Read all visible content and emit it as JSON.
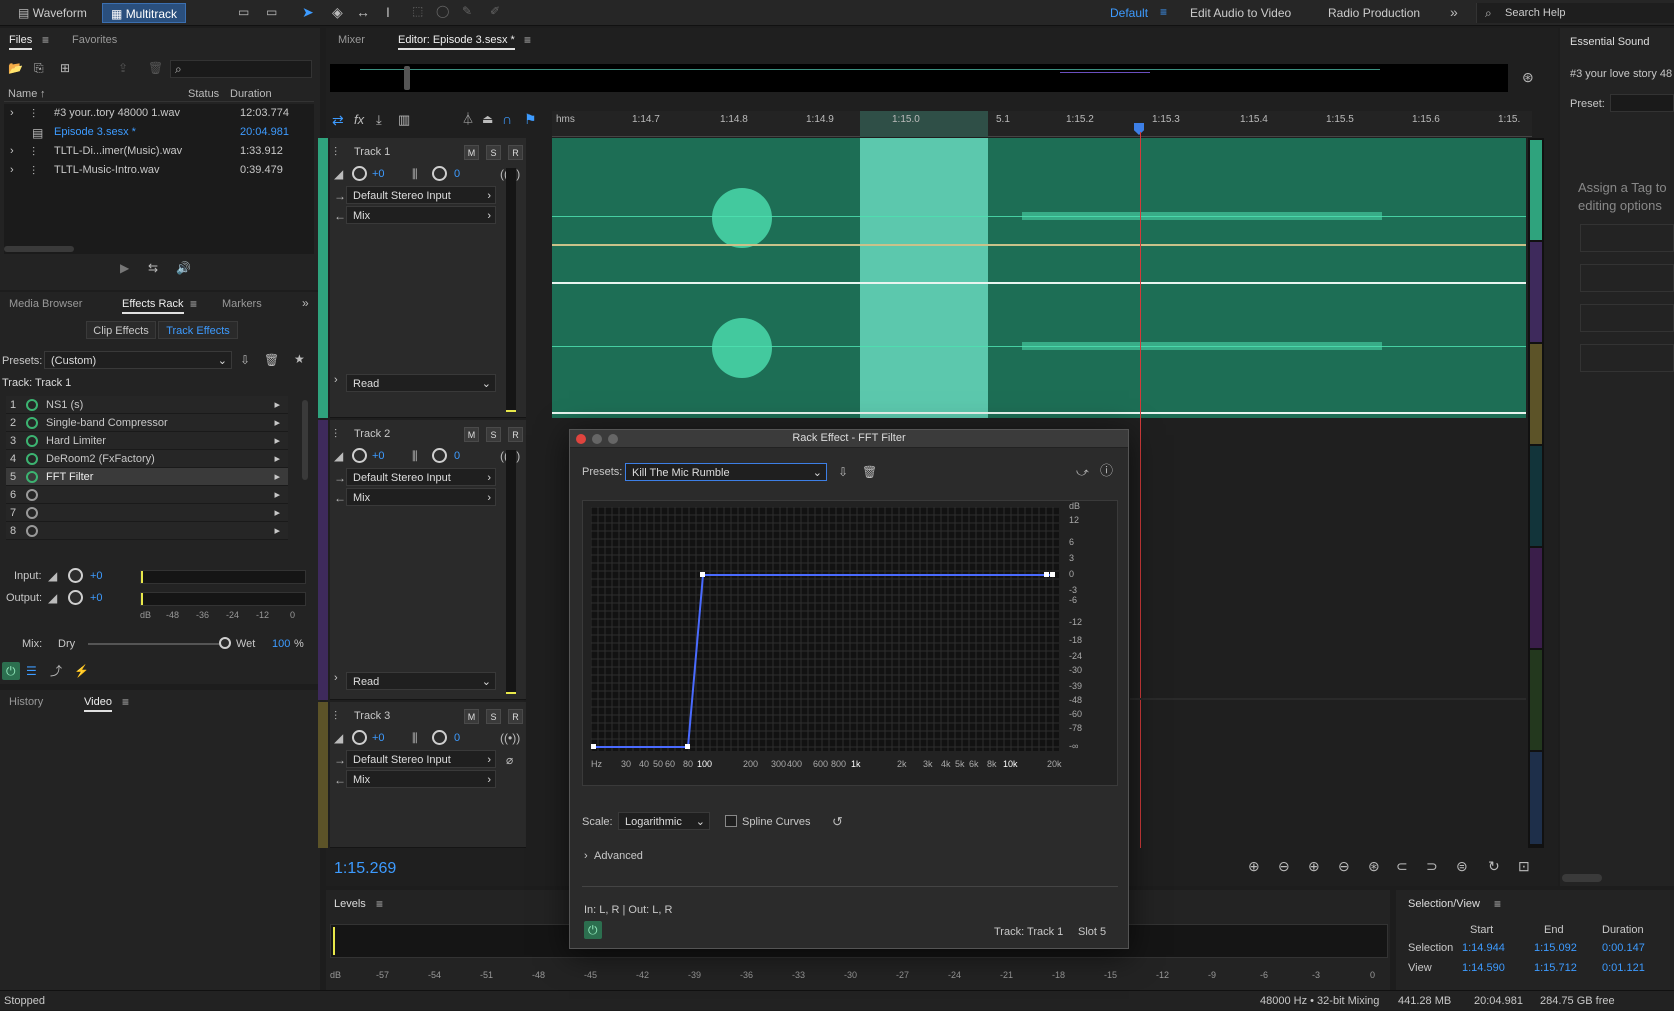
{
  "topbar": {
    "waveform": "Waveform",
    "multitrack": "Multitrack",
    "workspaces": [
      "Default",
      "Edit Audio to Video",
      "Radio Production"
    ],
    "search": "Search Help"
  },
  "files": {
    "tab_files": "Files",
    "tab_favorites": "Favorites",
    "col_name": "Name",
    "col_status": "Status",
    "col_duration": "Duration",
    "rows": [
      {
        "name": "#3 your..tory 48000 1.wav",
        "duration": "12:03.774"
      },
      {
        "name": "Episode 3.sesx *",
        "duration": "20:04.981"
      },
      {
        "name": "TLTL-Di...imer(Music).wav",
        "duration": "1:33.912"
      },
      {
        "name": "TLTL-Music-Intro.wav",
        "duration": "0:39.479"
      }
    ]
  },
  "rack": {
    "tabs": [
      "Media Browser",
      "Effects Rack",
      "Markers"
    ],
    "subtabs": [
      "Clip Effects",
      "Track Effects"
    ],
    "presets_label": "Presets:",
    "preset_value": "(Custom)",
    "track_label": "Track: Track 1",
    "effects": [
      {
        "n": "1",
        "name": "NS1 (s)"
      },
      {
        "n": "2",
        "name": "Single-band Compressor"
      },
      {
        "n": "3",
        "name": "Hard Limiter"
      },
      {
        "n": "4",
        "name": "DeRoom2 (FxFactory)"
      },
      {
        "n": "5",
        "name": "FFT Filter"
      },
      {
        "n": "6",
        "name": ""
      },
      {
        "n": "7",
        "name": ""
      },
      {
        "n": "8",
        "name": ""
      }
    ],
    "input_label": "Input:",
    "input_val": "+0",
    "output_label": "Output:",
    "output_val": "+0",
    "meter_ticks": [
      "dB",
      "-48",
      "-36",
      "-24",
      "-12",
      "0"
    ],
    "mix_label": "Mix:",
    "dry": "Dry",
    "wet": "Wet",
    "wet_pct": "100",
    "pct": "%"
  },
  "bottom_left": {
    "history": "History",
    "video": "Video"
  },
  "editor": {
    "tab_mixer": "Mixer",
    "tab_editor": "Editor: Episode 3.sesx *",
    "ruler": [
      "hms",
      "1:14.7",
      "1:14.8",
      "1:14.9",
      "1:15.0",
      "5.1",
      "1:15.2",
      "1:15.3",
      "1:15.4",
      "1:15.5",
      "1:15.6",
      "1:15."
    ],
    "tracks": [
      {
        "name": "Track 1",
        "vol": "+0",
        "pan": "0",
        "input": "Default Stereo Input",
        "out": "Mix",
        "auto": "Read"
      },
      {
        "name": "Track 2",
        "vol": "+0",
        "pan": "0",
        "input": "Default Stereo Input",
        "out": "Mix",
        "auto": "Read"
      },
      {
        "name": "Track 3",
        "vol": "+0",
        "pan": "0",
        "input": "Default Stereo Input",
        "out": "Mix"
      }
    ],
    "m": "M",
    "s": "S",
    "r": "R",
    "time": "1:15.269"
  },
  "levels": {
    "title": "Levels",
    "ticks": [
      "dB",
      "-57",
      "-54",
      "-51",
      "-48",
      "-45",
      "-42",
      "-39",
      "-36",
      "-33",
      "-30",
      "-27",
      "-24",
      "-21",
      "-18",
      "-15",
      "-12",
      "-9",
      "-6",
      "-3",
      "0"
    ]
  },
  "selview": {
    "title": "Selection/View",
    "h_start": "Start",
    "h_end": "End",
    "h_dur": "Duration",
    "sel_label": "Selection",
    "sel_start": "1:14.944",
    "sel_end": "1:15.092",
    "sel_dur": "0:00.147",
    "view_label": "View",
    "view_start": "1:14.590",
    "view_end": "1:15.712",
    "view_dur": "0:01.121"
  },
  "status": {
    "left": "Stopped",
    "rate": "48000 Hz • 32-bit Mixing",
    "mem": "441.28 MB",
    "dur": "20:04.981",
    "free": "284.75 GB free"
  },
  "essential": {
    "title": "Essential Sound",
    "file": "#3 your love story 48",
    "preset": "Preset:",
    "assign": "Assign a Tag to",
    "editing": "editing options"
  },
  "dialog": {
    "title": "Rack Effect - FFT Filter",
    "presets_label": "Presets:",
    "preset": "Kill The Mic Rumble",
    "db_ticks": [
      "dB",
      "12",
      "6",
      "3",
      "0",
      "-3",
      "-6",
      "-12",
      "-18",
      "-24",
      "-30",
      "-39",
      "-48",
      "-60",
      "-78",
      "-∞"
    ],
    "hz_ticks": [
      "Hz",
      "30",
      "40",
      "50",
      "60",
      "80",
      "100",
      "200",
      "300",
      "400",
      "600",
      "800",
      "1k",
      "2k",
      "3k",
      "4k",
      "5k",
      "6k",
      "8k",
      "10k",
      "20k"
    ],
    "scale_label": "Scale:",
    "scale": "Logarithmic",
    "spline": "Spline Curves",
    "advanced": "Advanced",
    "io": "In: L, R | Out: L, R",
    "track": "Track: Track 1",
    "slot": "Slot 5"
  },
  "colors": {
    "accent": "#3d9bff",
    "wave": "#1d6e55",
    "selection": "#67d8bd",
    "playhead": "#d23b3b",
    "curve": "#4a6bff"
  }
}
